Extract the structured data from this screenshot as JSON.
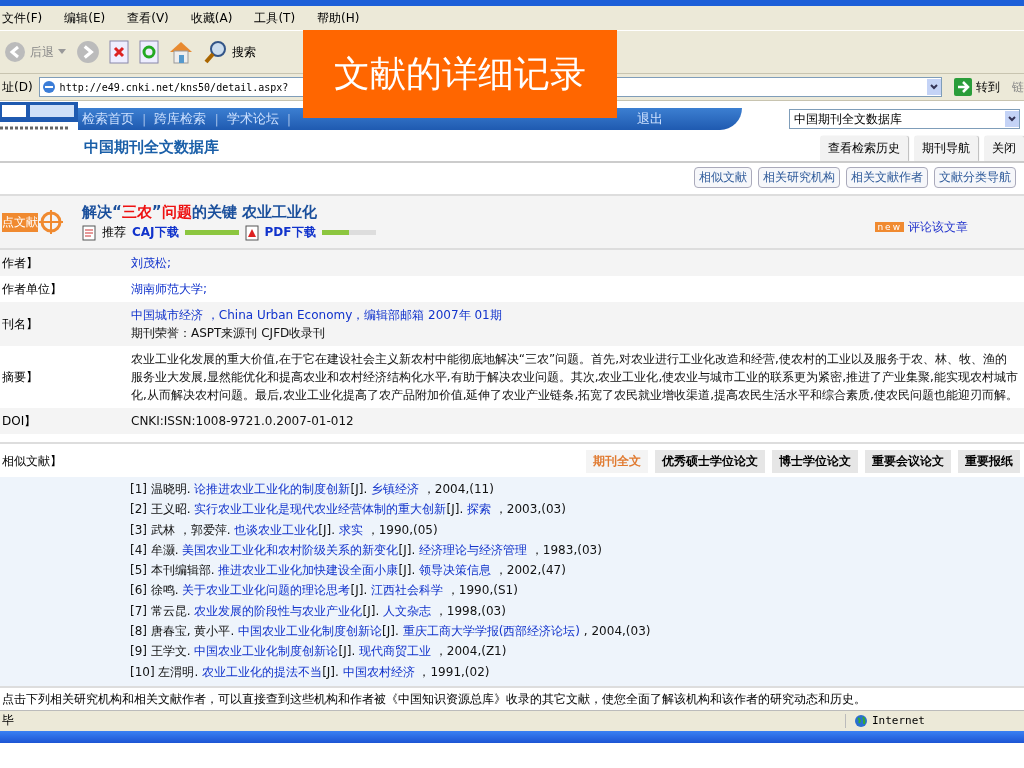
{
  "menu": [
    "文件(F)",
    "编辑(E)",
    "查看(V)",
    "收藏(A)",
    "工具(T)",
    "帮助(H)"
  ],
  "toolbar": {
    "back": "后退",
    "search": "搜索"
  },
  "address": {
    "label": "址(D)",
    "url": "http://e49.cnki.net/kns50/detail.aspx?",
    "go": "转到",
    "links": "链"
  },
  "overlay": "文献的详细记录",
  "site_nav": {
    "separator": "|",
    "items": [
      "检索首页",
      "跨库检索",
      "学术论坛"
    ],
    "exit": "退出",
    "database_select": "中国期刊全文数据库",
    "subtitle": "中国期刊全文数据库",
    "buttons": [
      "查看检索历史",
      "期刊导航",
      "关闭"
    ]
  },
  "related_links": [
    "相似文献",
    "相关研究机构",
    "相关文献作者",
    "文献分类导航"
  ],
  "article": {
    "badge": "点文献",
    "title_parts": [
      {
        "text": "解决“",
        "highlight": false
      },
      {
        "text": "三农",
        "highlight": true
      },
      {
        "text": "”",
        "highlight": false
      },
      {
        "text": "问题",
        "highlight": true
      },
      {
        "text": "的关键  农业工业化",
        "highlight": false
      }
    ],
    "recommend": "推荐",
    "downloads": [
      {
        "kind": "caj",
        "label": "CAJ下载",
        "level": 1.0
      },
      {
        "kind": "pdf",
        "label": "PDF下载",
        "level": 0.5
      }
    ],
    "new_badge": "new",
    "comment": "评论该文章"
  },
  "fields": [
    {
      "label": "作者】",
      "lines": [
        {
          "text": "刘茂松;",
          "link": true
        }
      ]
    },
    {
      "label": "作者单位】",
      "lines": [
        {
          "text": "湖南师范大学;",
          "link": true
        }
      ]
    },
    {
      "label": "刊名】",
      "lines": [
        {
          "text": "中国城市经济 ，China Urban Economy，编辑部邮箱  2007年  01期",
          "link": true
        },
        {
          "text": "期刊荣誉：ASPT来源刊  CJFD收录刊",
          "link": false
        }
      ]
    },
    {
      "label": "摘要】",
      "lines": [
        {
          "text": "农业工业化发展的重大价值,在于它在建设社会主义新农村中能彻底地解决“三农”问题。首先,对农业进行工业化改造和经营,使农村的工业以及服务于农、林、牧、渔的服务业大发展,显然能优化和提高农业和农村经济结构化水平,有助于解决农业问题。其次,农业工业化,使农业与城市工业的联系更为紧密,推进了产业集聚,能实现农村城市化,从而解决农村问题。最后,农业工业化提高了农产品附加价值,延伸了农业产业链条,拓宽了农民就业增收渠道,提高农民生活水平和综合素质,使农民问题也能迎刃而解。",
          "link": false
        }
      ]
    },
    {
      "label": "DOI】",
      "lines": [
        {
          "text": "CNKI:ISSN:1008-9721.0.2007-01-012",
          "link": false
        }
      ]
    }
  ],
  "similar": {
    "label": "相似文献】",
    "tabs": [
      {
        "label": "期刊全文",
        "selected": true
      },
      {
        "label": "优秀硕士学位论文",
        "selected": false
      },
      {
        "label": "博士学位论文",
        "selected": false
      },
      {
        "label": "重要会议论文",
        "selected": false
      },
      {
        "label": "重要报纸",
        "selected": false
      }
    ],
    "references": [
      {
        "number": "[1]",
        "authors": "温晓明.",
        "title": "论推进农业工业化的制度创新",
        "type": "[J].",
        "journal": "乡镇经济",
        "issue": " ，2004,(11)"
      },
      {
        "number": "[2]",
        "authors": "王义昭.",
        "title": "实行农业工业化是现代农业经营体制的重大创新",
        "type": "[J].",
        "journal": "探索",
        "issue": " ，2003,(03)"
      },
      {
        "number": "[3]",
        "authors": "武林 ，郭爱萍.",
        "title": "也谈农业工业化",
        "type": "[J].",
        "journal": "求实",
        "issue": " ，1990,(05)"
      },
      {
        "number": "[4]",
        "authors": "牟灏.",
        "title": "美国农业工业化和农村阶级关系的新变化",
        "type": "[J].",
        "journal": "经济理论与经济管理",
        "issue": " ，1983,(03)"
      },
      {
        "number": "[5]",
        "authors": "本刊编辑部.",
        "title": "推进农业工业化加快建设全面小康",
        "type": "[J].",
        "journal": "领导决策信息",
        "issue": " ，2002,(47)"
      },
      {
        "number": "[6]",
        "authors": "徐鸣.",
        "title": "关于农业工业化问题的理论思考",
        "type": "[J].",
        "journal": "江西社会科学",
        "issue": " ，1990,(S1)"
      },
      {
        "number": "[7]",
        "authors": "常云昆.",
        "title": "农业发展的阶段性与农业产业化",
        "type": "[J].",
        "journal": "人文杂志",
        "issue": " ，1998,(03)"
      },
      {
        "number": "[8]",
        "authors": "唐春宝, 黄小平.",
        "title": "中国农业工业化制度创新论",
        "type": "[J].",
        "journal": "重庆工商大学学报(西部经济论坛)",
        "issue": " , 2004,(03)"
      },
      {
        "number": "[9]",
        "authors": "王学文.",
        "title": "中国农业工业化制度创新论",
        "type": "[J].",
        "journal": "现代商贸工业",
        "issue": " ，2004,(Z1)"
      },
      {
        "number": "[10]",
        "authors": "左渭明.",
        "title": "农业工业化的提法不当",
        "type": "[J].",
        "journal": "中国农村经济",
        "issue": " ，1991,(02)"
      }
    ]
  },
  "note": "点击下列相关研究机构和相关文献作者，可以直接查到这些机构和作者被《中国知识资源总库》收录的其它文献，使您全面了解该机构和该作者的研究动态和历史。",
  "status": {
    "text": "毕",
    "zone": "Internet"
  }
}
